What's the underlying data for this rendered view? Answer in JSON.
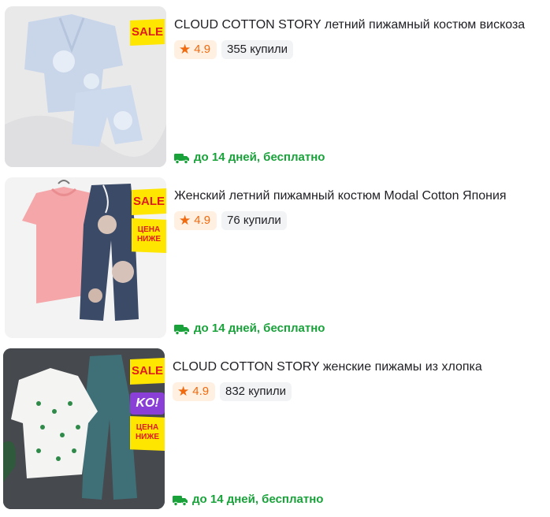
{
  "products": [
    {
      "title": "CLOUD COTTON STORY летний пижамный костюм вискоза",
      "rating": "4.9",
      "sold": "355 купили",
      "delivery": "до 14 дней, бесплатно",
      "badges": {
        "sale": "SALE"
      }
    },
    {
      "title": "Женский летний пижамный костюм Modal Cotton Япония",
      "rating": "4.9",
      "sold": "76 купили",
      "delivery": "до 14 дней, бесплатно",
      "badges": {
        "sale": "SALE",
        "price_line1": "ЦЕНА",
        "price_line2": "НИЖЕ"
      }
    },
    {
      "title": "CLOUD COTTON STORY женские пижамы из хлопка",
      "rating": "4.9",
      "sold": "832 купили",
      "delivery": "до 14 дней, бесплатно",
      "badges": {
        "sale": "SALE",
        "ko": "KO!",
        "price_line1": "ЦЕНА",
        "price_line2": "НИЖЕ"
      }
    }
  ],
  "icons": {
    "rating": "star-icon",
    "delivery": "truck-icon"
  },
  "colors": {
    "rating": "#f06a0f",
    "rating_bg": "#fff0e2",
    "delivery": "#19a23a",
    "sale_badge": "#ffe600",
    "sale_text": "#e01b1b",
    "ko_badge": "#8a3fd6"
  }
}
